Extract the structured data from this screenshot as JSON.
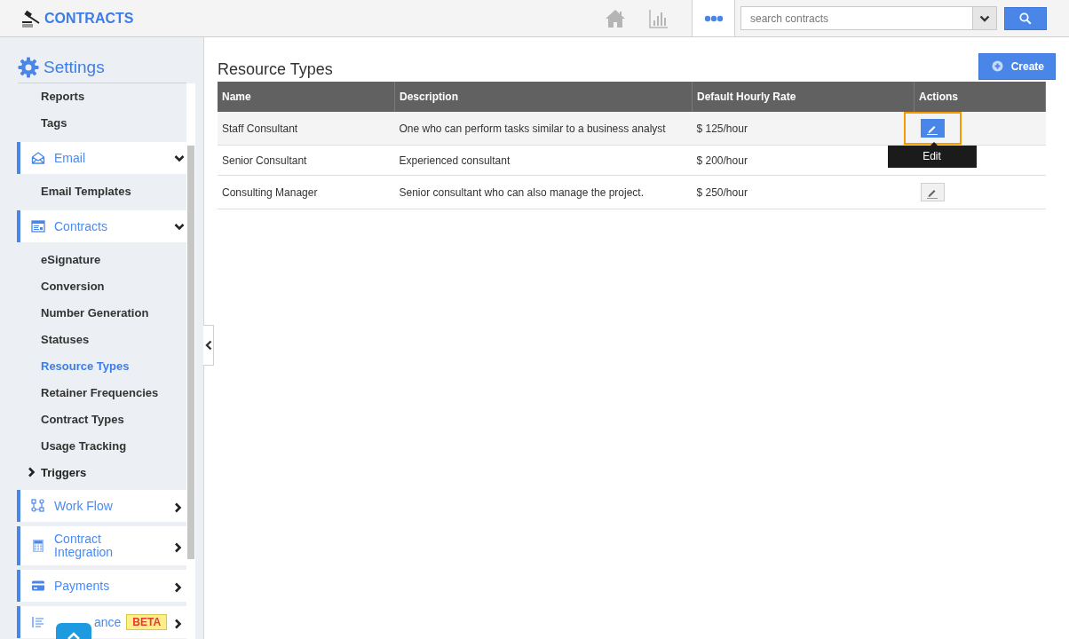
{
  "app": {
    "title": "CONTRACTS"
  },
  "search": {
    "placeholder": "search contracts"
  },
  "sidebar": {
    "title": "Settings",
    "items": [
      {
        "kind": "sub",
        "label": "Reports",
        "selected": false
      },
      {
        "kind": "sub",
        "label": "Tags",
        "selected": false
      },
      {
        "kind": "section",
        "label": "Email",
        "expanded": true
      },
      {
        "kind": "sub",
        "label": "Email Templates",
        "selected": false
      },
      {
        "kind": "section",
        "label": "Contracts",
        "expanded": true
      },
      {
        "kind": "sub",
        "label": "eSignature",
        "selected": false
      },
      {
        "kind": "sub",
        "label": "Conversion",
        "selected": false
      },
      {
        "kind": "sub",
        "label": "Number Generation",
        "selected": false
      },
      {
        "kind": "sub",
        "label": "Statuses",
        "selected": false
      },
      {
        "kind": "sub",
        "label": "Resource Types",
        "selected": true
      },
      {
        "kind": "sub",
        "label": "Retainer Frequencies",
        "selected": false
      },
      {
        "kind": "sub",
        "label": "Contract Types",
        "selected": false
      },
      {
        "kind": "sub",
        "label": "Usage Tracking",
        "selected": false
      },
      {
        "kind": "group",
        "label": "Triggers",
        "expanded": false
      },
      {
        "kind": "section",
        "label": "Work Flow",
        "expanded": false
      },
      {
        "kind": "section",
        "label": "Contract Integration",
        "expanded": false
      },
      {
        "kind": "section",
        "label": "Payments",
        "expanded": false
      },
      {
        "kind": "section",
        "label": "ance",
        "expanded": false,
        "badge": "BETA"
      }
    ]
  },
  "page": {
    "title": "Resource Types",
    "create_button": "Create"
  },
  "table": {
    "columns": [
      "Name",
      "Description",
      "Default Hourly Rate",
      "Actions"
    ],
    "rows": [
      {
        "cells": [
          "Staff Consultant",
          "One who can perform tasks similar to a business analyst",
          "$ 125/hour"
        ],
        "hovered": true,
        "edit_button": true,
        "tooltip": "Edit"
      },
      {
        "cells": [
          "Senior Consultant",
          "Experienced consultant",
          "$ 200/hour"
        ],
        "hovered": false,
        "edit_button": false
      },
      {
        "cells": [
          "Consulting Manager",
          "Senior consultant who can also manage the project.",
          "$ 250/hour"
        ],
        "hovered": false,
        "edit_button": true
      }
    ]
  }
}
